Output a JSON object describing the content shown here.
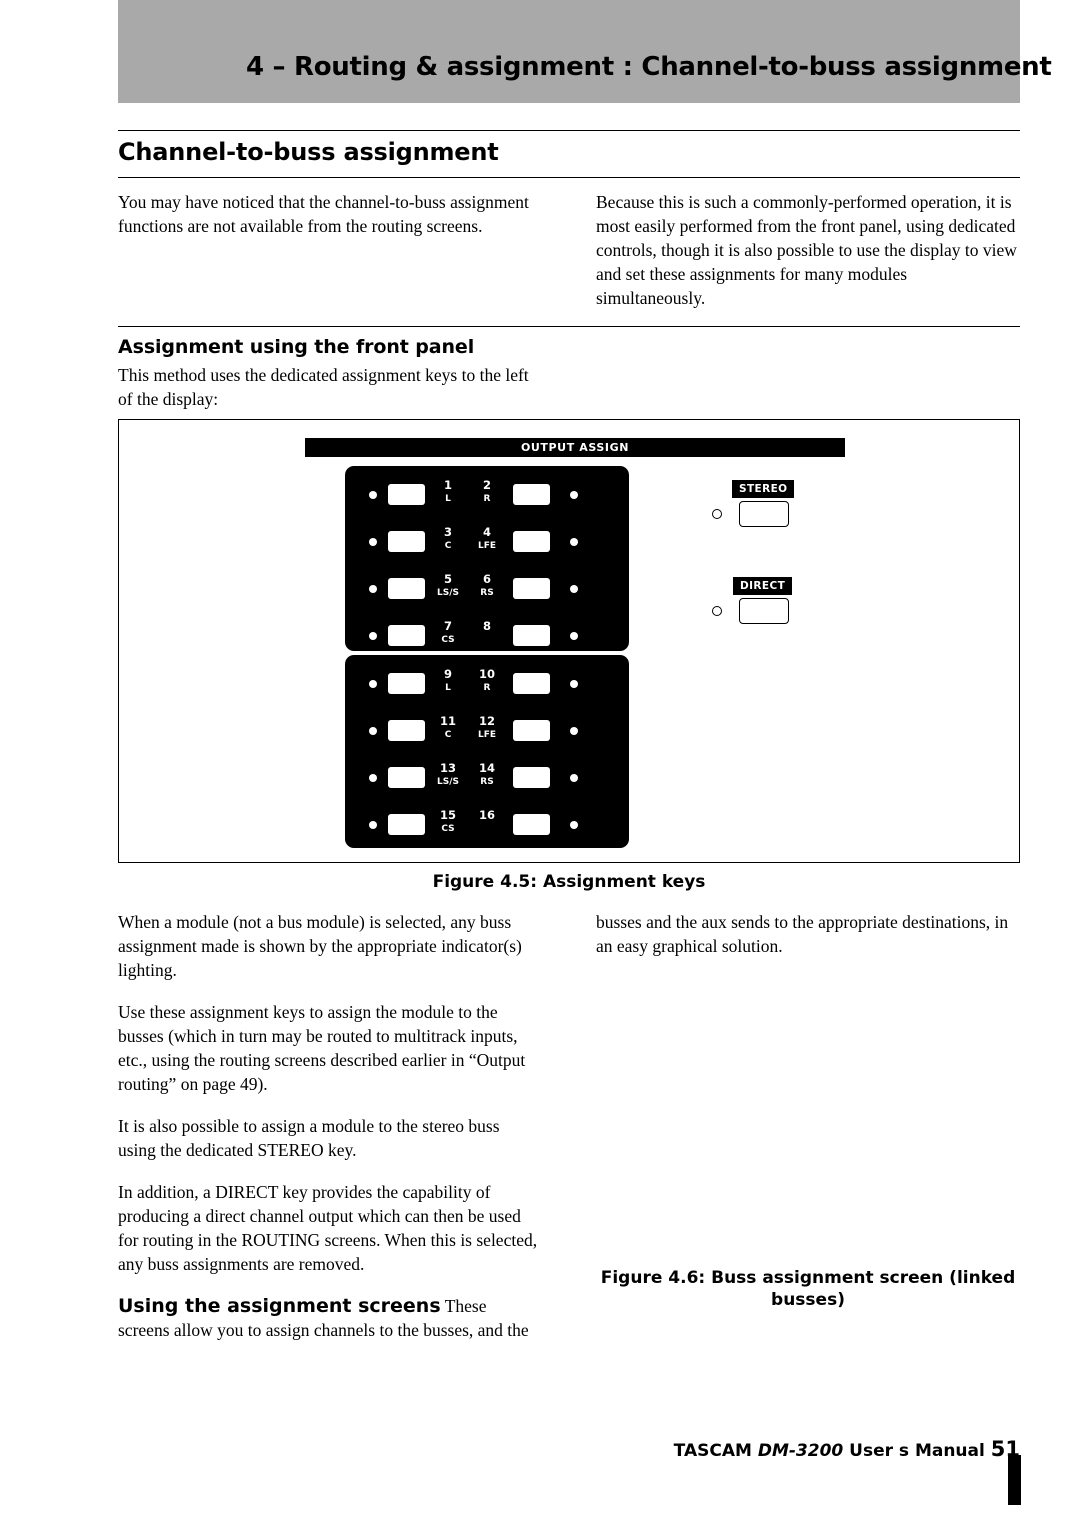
{
  "header": {
    "title": "4 – Routing & assignment : Channel-to-buss assignment"
  },
  "section": {
    "title": "Channel-to-buss assignment"
  },
  "intro": {
    "left": "You may have noticed that the channel-to-buss assignment functions are not available from the routing screens.",
    "right": "Because this is such a commonly-performed operation, it is most easily performed from the front panel, using dedicated controls, though it is also possible to use the display to view and set these assignments for many modules simultaneously."
  },
  "subheads": {
    "front_panel": "Assignment using the front panel"
  },
  "front_panel": {
    "intro": "This method uses the dedicated assignment keys to the left of the display:"
  },
  "figure45": {
    "caption": "Figure 4.5: Assignment keys",
    "output_assign_label": "OUTPUT ASSIGN",
    "stereo_label": "STEREO",
    "direct_label": "DIRECT",
    "keys": [
      {
        "num": "1",
        "sub": "L"
      },
      {
        "num": "2",
        "sub": "R"
      },
      {
        "num": "3",
        "sub": "C"
      },
      {
        "num": "4",
        "sub": "LFE"
      },
      {
        "num": "5",
        "sub": "LS/S"
      },
      {
        "num": "6",
        "sub": "RS"
      },
      {
        "num": "7",
        "sub": "CS"
      },
      {
        "num": "8",
        "sub": ""
      },
      {
        "num": "9",
        "sub": "L"
      },
      {
        "num": "10",
        "sub": "R"
      },
      {
        "num": "11",
        "sub": "C"
      },
      {
        "num": "12",
        "sub": "LFE"
      },
      {
        "num": "13",
        "sub": "LS/S"
      },
      {
        "num": "14",
        "sub": "RS"
      },
      {
        "num": "15",
        "sub": "CS"
      },
      {
        "num": "16",
        "sub": ""
      }
    ]
  },
  "body": {
    "left": [
      "When a module (not a bus module) is selected, any buss assignment made is shown by the appropriate indicator(s) lighting.",
      "Use these assignment keys to assign the module to the busses (which in turn may be routed to multitrack inputs, etc., using the routing screens described earlier in “Output routing” on page 49).",
      "It is also possible to assign a module to the stereo buss using the dedicated STEREO key.",
      "In addition, a DIRECT key provides the capability of producing a direct channel output which can then be used for routing in the ROUTING screens. When this is selected, any buss assignments are removed."
    ],
    "right": [
      "busses and the aux sends to the appropriate destinations, in an easy graphical solution."
    ]
  },
  "using_screens": {
    "head": "Using the assignment screens",
    "text": " These screens allow you to assign channels to the busses, and the"
  },
  "figure46": {
    "caption_line1": "Figure 4.6: Buss assignment screen (linked",
    "caption_line2": "busses)"
  },
  "footer": {
    "brand": "TASCAM ",
    "model": "DM-3200",
    "manual": " User s Manual ",
    "page": "51"
  }
}
